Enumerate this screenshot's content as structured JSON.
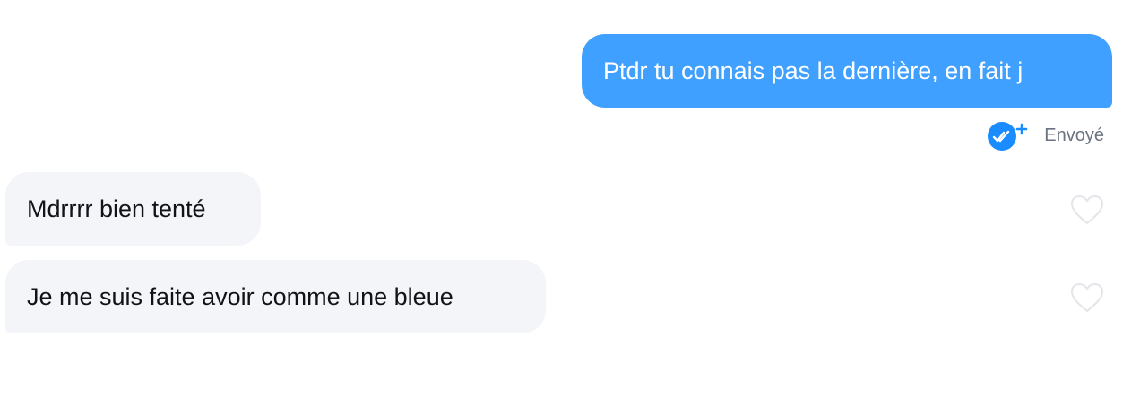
{
  "conversation": {
    "sent_message": {
      "text": "Ptdr tu connais pas la dernière, en fait j",
      "status": "Envoyé",
      "status_icon": "double-check-plus-icon"
    },
    "received_messages": [
      {
        "text": "Mdrrrr bien tenté",
        "reaction_icon": "heart-outline-icon"
      },
      {
        "text": "Je me suis faite avoir comme une bleue",
        "reaction_icon": "heart-outline-icon"
      }
    ]
  },
  "colors": {
    "sent_bubble": "#3fa0ff",
    "received_bubble": "#f4f5f8",
    "status_icon": "#1a8cff",
    "heart_outline": "#e3e5ea"
  }
}
